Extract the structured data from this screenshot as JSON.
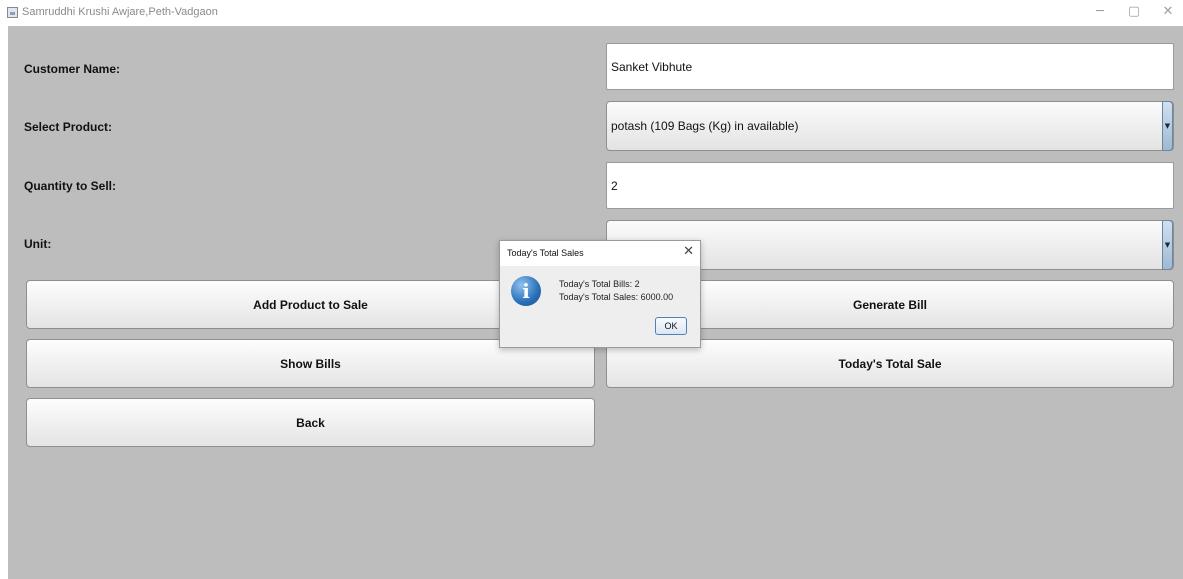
{
  "window": {
    "title": "Samruddhi Krushi Awjare,Peth-Vadgaon",
    "minimize_glyph": "─",
    "restore_glyph": "▢",
    "close_glyph": "✕"
  },
  "form": {
    "customer_name_label": "Customer Name:",
    "customer_name_value": "Sanket Vibhute",
    "select_product_label": "Select Product:",
    "selected_product": "potash (109 Bags (Kg) in available)",
    "quantity_label": "Quantity to Sell:",
    "quantity_value": "2",
    "unit_label": "Unit:",
    "unit_value": "",
    "dropdown_arrow_glyph": "▼"
  },
  "buttons": {
    "add_product": "Add Product to Sale",
    "generate_bill": "Generate Bill",
    "show_bills": "Show Bills",
    "todays_total_sale": "Today's Total Sale",
    "back": "Back"
  },
  "dialog": {
    "title": "Today's Total Sales",
    "close_glyph": "✕",
    "icon_glyph": "i",
    "total_bills_line": "Today's Total Bills: 2",
    "total_sales_line": "Today's Total Sales: 6000.00",
    "ok_label": "OK"
  }
}
